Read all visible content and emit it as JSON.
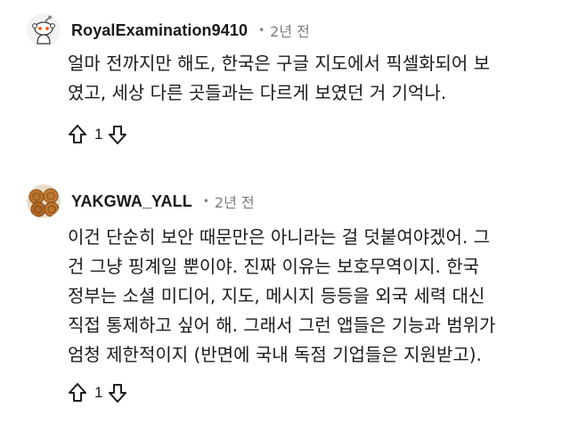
{
  "comments": [
    {
      "username": "RoyalExamination9410",
      "separator": "•",
      "time": "2년 전",
      "lines": [
        "얼마 전까지만 해도, 한국은 구글 지도에서 픽셀화되어 보",
        "였고, 세상 다른 곳들과는 다르게 보였던 거 기억나."
      ],
      "votes": "1"
    },
    {
      "username": "YAKGWA_YALL",
      "separator": "•",
      "time": "2년 전",
      "lines": [
        "이건 단순히 보안 때문만은 아니라는 걸 덧붙여야겠어. 그",
        "건 그냥 핑계일 뿐이야. 진짜 이유는 보호무역이지. 한국",
        "정부는 소셜 미디어, 지도, 메시지 등등을 외국 세력 대신",
        "직접 통제하고 싶어 해. 그래서 그런 앱들은 기능과 범위가",
        "엄청 제한적이지 (반면에 국내 독점 기업들은 지원받고)."
      ],
      "votes": "1"
    }
  ],
  "colors": {
    "text": "#1c1c1c",
    "meta": "#7c7c7c",
    "avatar_bg_1": "#f2f2f2"
  },
  "icons": {
    "upvote": "upvote-arrow-icon",
    "downvote": "downvote-arrow-icon"
  }
}
